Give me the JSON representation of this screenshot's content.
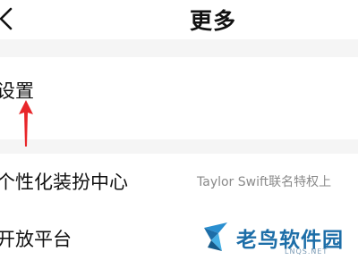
{
  "header": {
    "title": "更多",
    "back_icon": "chevron-left-icon"
  },
  "menu": {
    "items": [
      {
        "label": "设置",
        "value": ""
      },
      {
        "label": "个性化装扮中心",
        "value": "Taylor Swift联名特权上"
      },
      {
        "label": "开放平台",
        "value": ""
      }
    ]
  },
  "annotation": {
    "arrow_icon": "red-up-arrow-icon",
    "color": "#e8262a"
  },
  "watermark": {
    "text": "老鸟软件园",
    "sub": "LNQS.NET",
    "color": "#1d6ea8"
  }
}
